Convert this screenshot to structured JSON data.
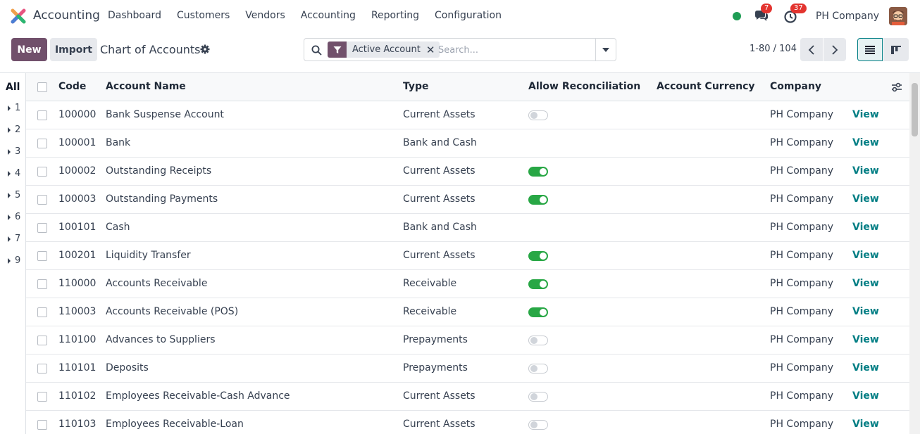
{
  "nav": {
    "app_name": "Accounting",
    "menu": [
      "Dashboard",
      "Customers",
      "Vendors",
      "Accounting",
      "Reporting",
      "Configuration"
    ],
    "messages_count": "7",
    "activities_count": "37",
    "company": "PH Company"
  },
  "control": {
    "new_label": "New",
    "import_label": "Import",
    "title": "Chart of Accounts",
    "facet_label": "Active Account",
    "search_placeholder": "Search...",
    "pager": "1-80 / 104"
  },
  "side": {
    "all_label": "All",
    "groups": [
      "1",
      "2",
      "3",
      "4",
      "5",
      "6",
      "7",
      "9"
    ]
  },
  "table": {
    "headers": {
      "code": "Code",
      "name": "Account Name",
      "type": "Type",
      "reconcile": "Allow Reconciliation",
      "currency": "Account Currency",
      "company": "Company"
    },
    "view_label": "View",
    "rows": [
      {
        "code": "100000",
        "name": "Bank Suspense Account",
        "type": "Current Assets",
        "reconcile": "off",
        "company": "PH Company"
      },
      {
        "code": "100001",
        "name": "Bank",
        "type": "Bank and Cash",
        "reconcile": "none",
        "company": "PH Company"
      },
      {
        "code": "100002",
        "name": "Outstanding Receipts",
        "type": "Current Assets",
        "reconcile": "on",
        "company": "PH Company"
      },
      {
        "code": "100003",
        "name": "Outstanding Payments",
        "type": "Current Assets",
        "reconcile": "on",
        "company": "PH Company"
      },
      {
        "code": "100101",
        "name": "Cash",
        "type": "Bank and Cash",
        "reconcile": "none",
        "company": "PH Company"
      },
      {
        "code": "100201",
        "name": "Liquidity Transfer",
        "type": "Current Assets",
        "reconcile": "on",
        "company": "PH Company"
      },
      {
        "code": "110000",
        "name": "Accounts Receivable",
        "type": "Receivable",
        "reconcile": "on",
        "company": "PH Company"
      },
      {
        "code": "110003",
        "name": "Accounts Receivable (POS)",
        "type": "Receivable",
        "reconcile": "on",
        "company": "PH Company"
      },
      {
        "code": "110100",
        "name": "Advances to Suppliers",
        "type": "Prepayments",
        "reconcile": "off",
        "company": "PH Company"
      },
      {
        "code": "110101",
        "name": "Deposits",
        "type": "Prepayments",
        "reconcile": "off",
        "company": "PH Company"
      },
      {
        "code": "110102",
        "name": "Employees Receivable-Cash Advance",
        "type": "Current Assets",
        "reconcile": "off",
        "company": "PH Company"
      },
      {
        "code": "110103",
        "name": "Employees Receivable-Loan",
        "type": "Current Assets",
        "reconcile": "off",
        "company": "PH Company"
      }
    ]
  },
  "colors": {
    "brand": "#71506b",
    "link": "#017e84",
    "toggle_on": "#28a745"
  }
}
